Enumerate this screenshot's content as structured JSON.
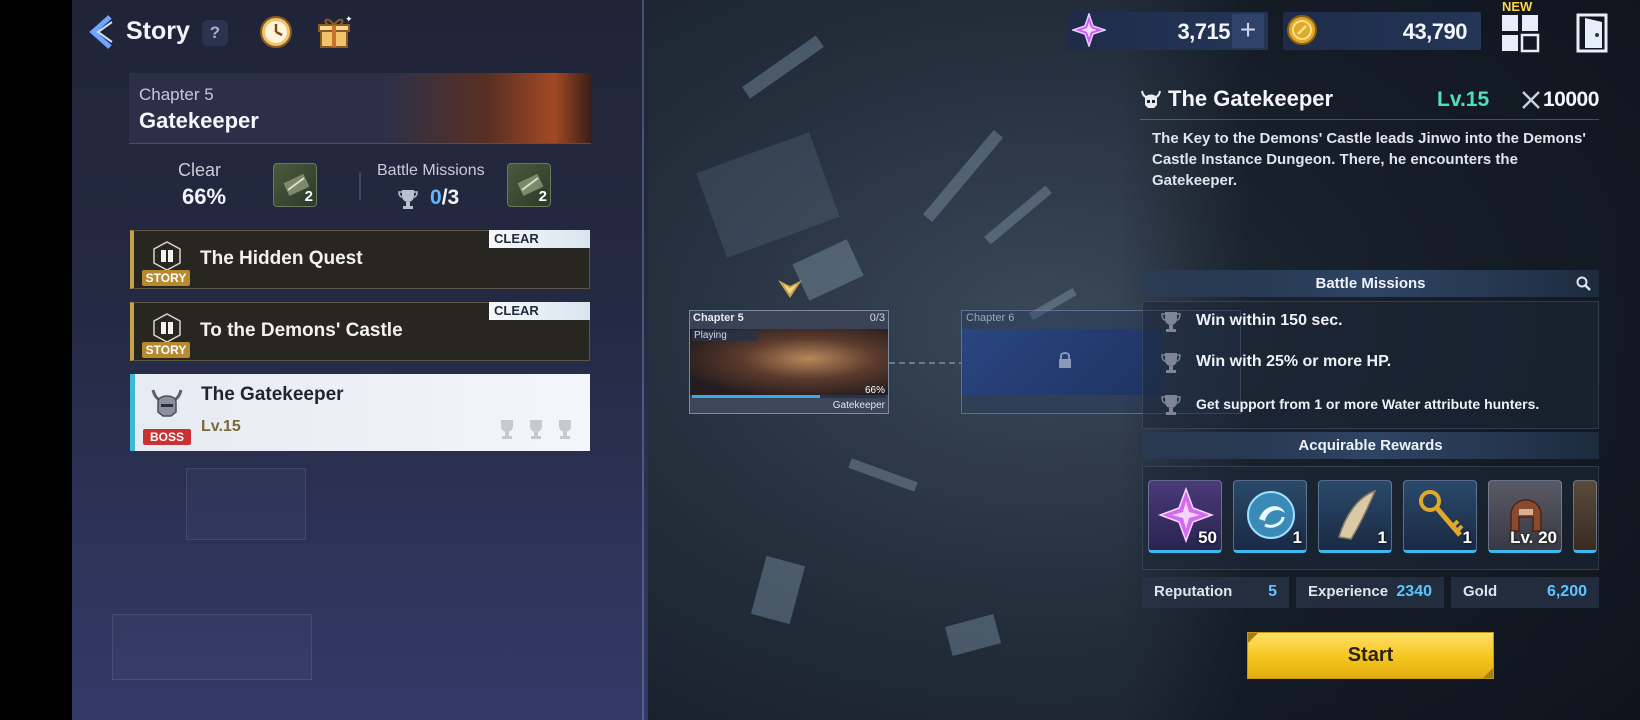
{
  "header": {
    "title": "Story",
    "help_label": "?"
  },
  "currency": {
    "gems": "3,715",
    "plus": "+",
    "gold": "43,790",
    "new_badge": "NEW"
  },
  "chapter": {
    "label": "Chapter 5",
    "name": "Gatekeeper",
    "clear_label": "Clear",
    "clear_percent": "66%",
    "clear_reward_count": "2",
    "battle_missions_label": "Battle Missions",
    "battle_missions_done": "0",
    "battle_missions_total": "/3",
    "battle_reward_count": "2"
  },
  "quests": [
    {
      "name": "The Hidden Quest",
      "tag": "STORY",
      "status": "CLEAR"
    },
    {
      "name": "To the Demons' Castle",
      "tag": "STORY",
      "status": "CLEAR"
    },
    {
      "name": "The Gatekeeper",
      "tag": "BOSS",
      "level": "Lv.15"
    }
  ],
  "map": {
    "node5": {
      "title": "Chapter 5",
      "status": "Playing",
      "trophies": "0/3",
      "progress": "66%",
      "progress_value": 0.66,
      "footer": "Gatekeeper"
    },
    "node6": {
      "title": "Chapter 6"
    }
  },
  "detail": {
    "title": "The Gatekeeper",
    "level": "Lv.15",
    "power": "10000",
    "description": "The Key to the Demons' Castle leads Jinwo into the Demons' Castle Instance Dungeon. There, he encounters the Gatekeeper.",
    "missions_header": "Battle Missions",
    "missions": [
      "Win within 150 sec.",
      "Win with 25% or more HP.",
      "Get support from 1 or more Water attribute hunters."
    ],
    "rewards_header": "Acquirable Rewards",
    "rewards": [
      {
        "icon": "purple-star-gem-icon",
        "qty": "50"
      },
      {
        "icon": "blue-swirl-orb-icon",
        "qty": "1"
      },
      {
        "icon": "horn-fang-icon",
        "qty": "1"
      },
      {
        "icon": "golden-key-icon",
        "qty": "1"
      },
      {
        "icon": "leather-helmet-icon",
        "qty": "Lv. 20"
      }
    ],
    "stats": [
      {
        "label": "Reputation",
        "value": "5"
      },
      {
        "label": "Experience",
        "value": "2340"
      },
      {
        "label": "Gold",
        "value": "6,200"
      }
    ],
    "start_label": "Start"
  },
  "colors": {
    "accent_gold": "#f5c61e",
    "level_teal": "#4fe0c0",
    "value_blue": "#5bc6ff",
    "boss_red": "#c93232",
    "story_gold": "#b78a2f"
  }
}
